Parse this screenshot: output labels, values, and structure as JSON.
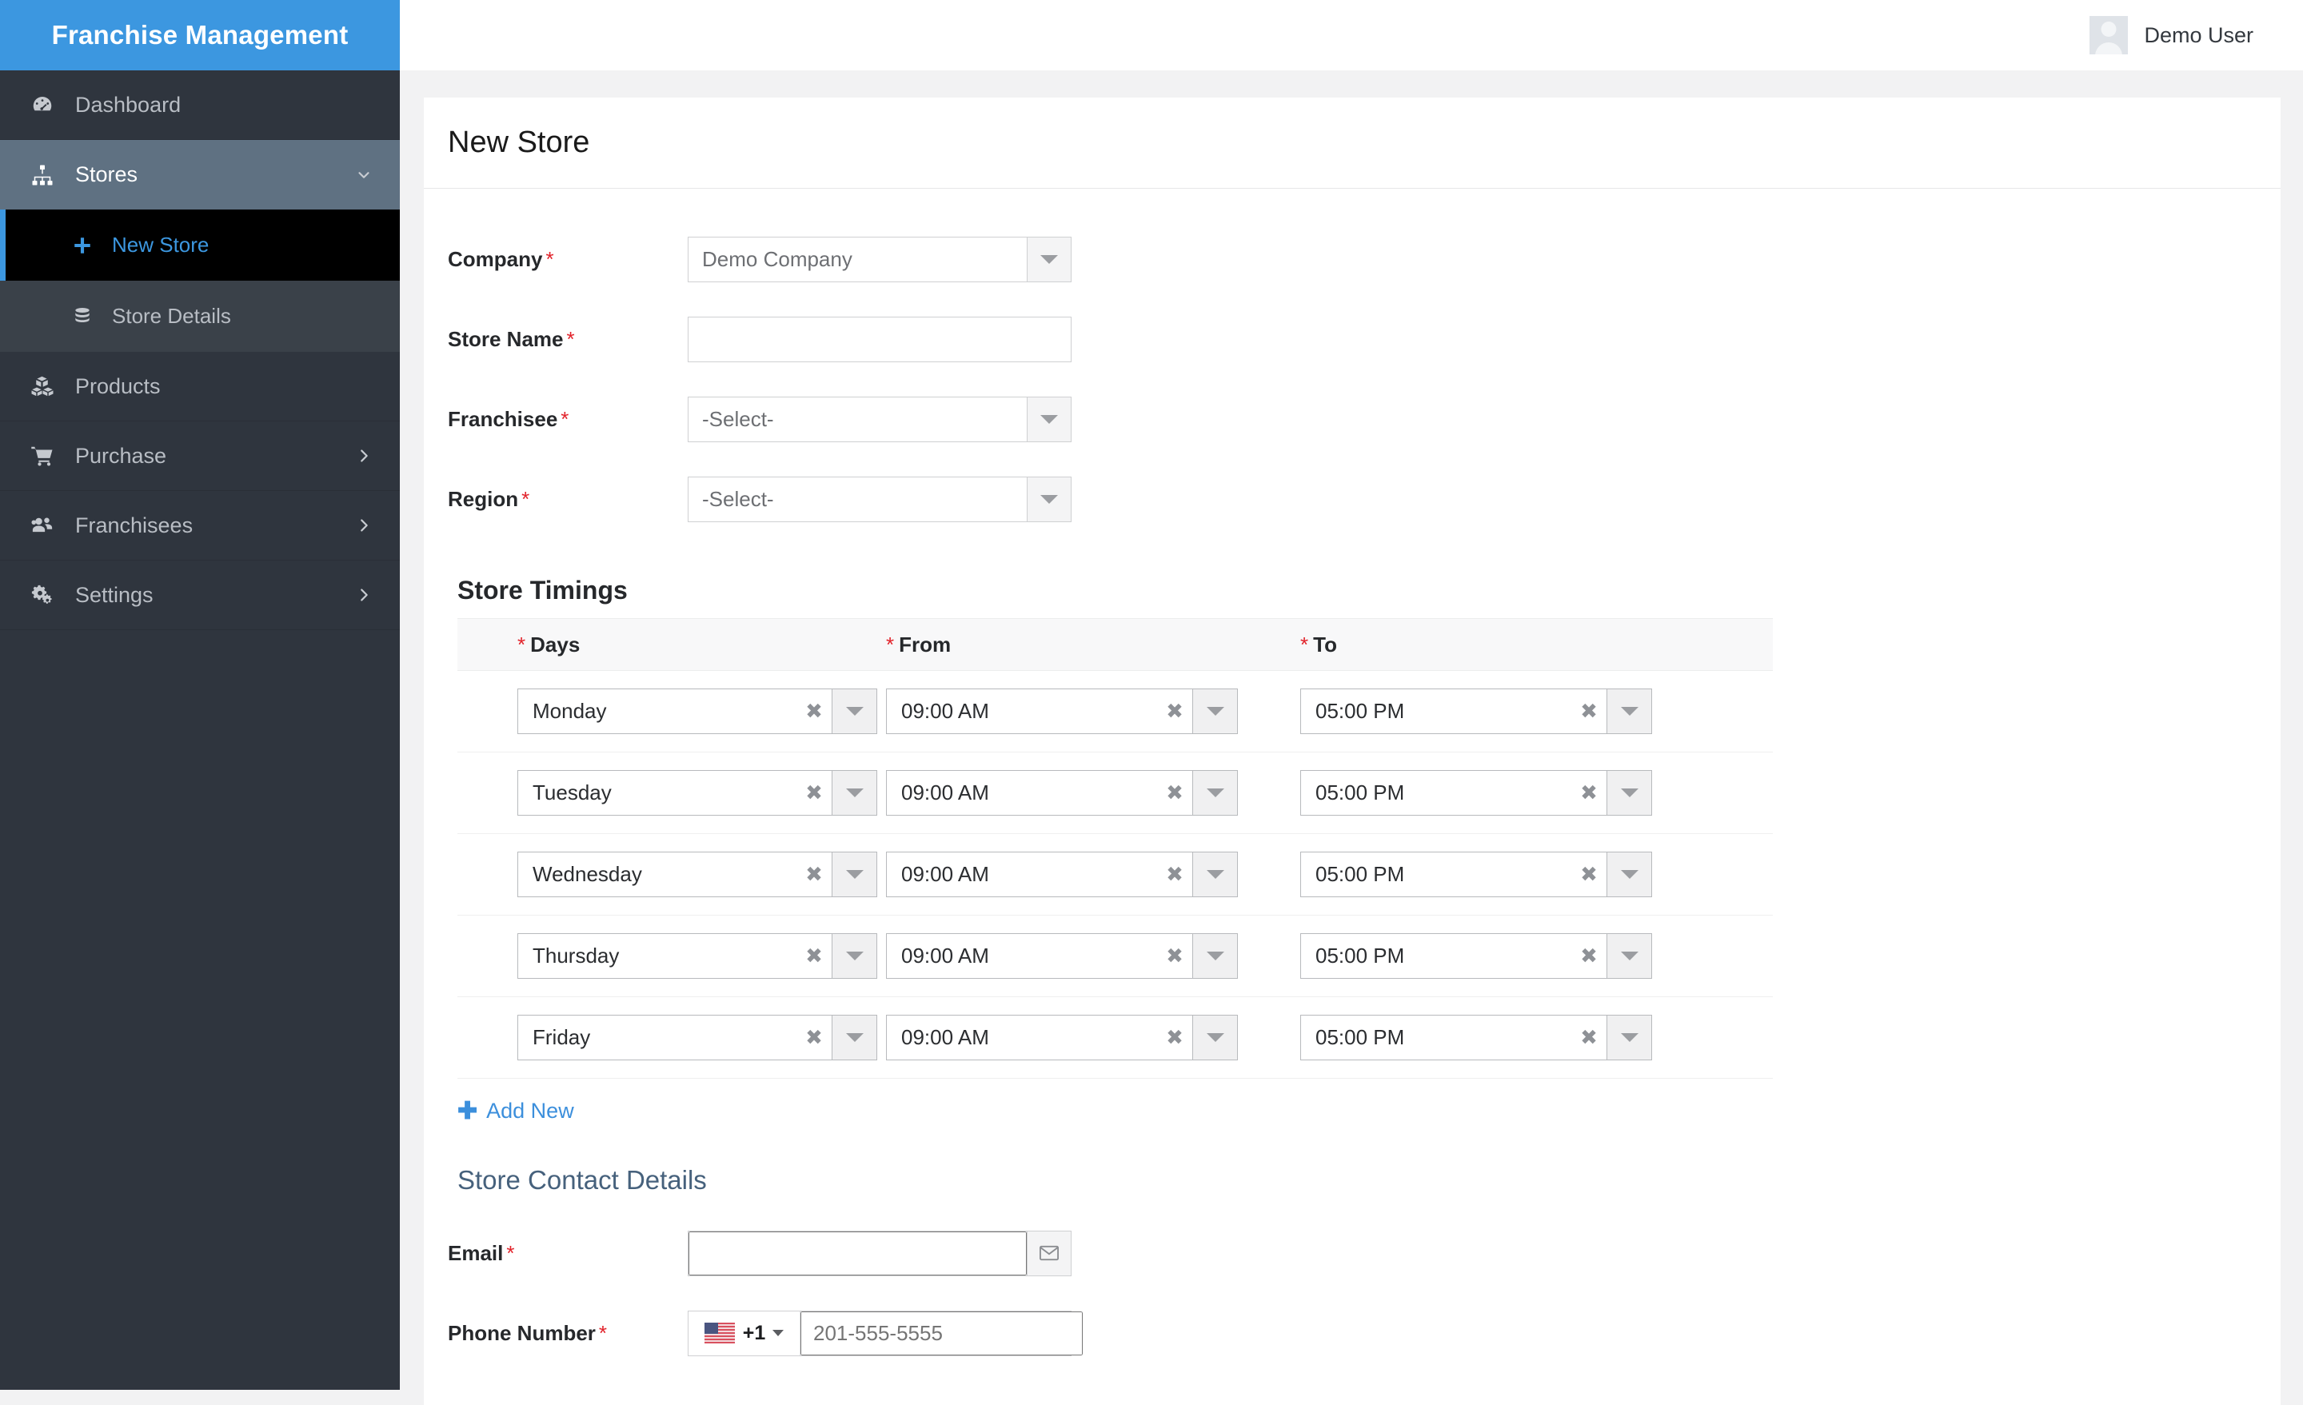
{
  "brand": {
    "title": "Franchise Management"
  },
  "topbar": {
    "user_name": "Demo User"
  },
  "sidebar": {
    "items": [
      {
        "label": "Dashboard",
        "icon": "dashboard-icon",
        "caret": ""
      },
      {
        "label": "Stores",
        "icon": "sitemap-icon",
        "caret": "chevron-down-icon"
      },
      {
        "label": "Products",
        "icon": "boxes-icon",
        "caret": ""
      },
      {
        "label": "Purchase",
        "icon": "shopping-cart-icon",
        "caret": "chevron-right-icon"
      },
      {
        "label": "Franchisees",
        "icon": "users-icon",
        "caret": "chevron-right-icon"
      },
      {
        "label": "Settings",
        "icon": "gears-icon",
        "caret": "chevron-right-icon"
      }
    ],
    "sub_items": [
      {
        "label": "New Store",
        "icon": "plus-icon"
      },
      {
        "label": "Store Details",
        "icon": "database-icon"
      }
    ]
  },
  "page": {
    "title": "New Store"
  },
  "form": {
    "company": {
      "label": "Company",
      "required": "*",
      "value": "Demo Company"
    },
    "store_name": {
      "label": "Store Name",
      "required": "*",
      "value": ""
    },
    "franchisee": {
      "label": "Franchisee",
      "required": "*",
      "value": "-Select-"
    },
    "region": {
      "label": "Region",
      "required": "*",
      "value": "-Select-"
    }
  },
  "timings": {
    "title": "Store Timings",
    "required_marker": "*",
    "columns": [
      "Days",
      "From",
      "To"
    ],
    "rows": [
      {
        "day": "Monday",
        "from": "09:00 AM",
        "to": "05:00 PM"
      },
      {
        "day": "Tuesday",
        "from": "09:00 AM",
        "to": "05:00 PM"
      },
      {
        "day": "Wednesday",
        "from": "09:00 AM",
        "to": "05:00 PM"
      },
      {
        "day": "Thursday",
        "from": "09:00 AM",
        "to": "05:00 PM"
      },
      {
        "day": "Friday",
        "from": "09:00 AM",
        "to": "05:00 PM"
      }
    ],
    "clear_glyph": "✖",
    "add_new_label": "Add New",
    "add_new_glyph": "✚"
  },
  "contact": {
    "title": "Store Contact Details",
    "email": {
      "label": "Email",
      "required": "*",
      "value": "",
      "icon": "envelope-icon"
    },
    "phone": {
      "label": "Phone Number",
      "required": "*",
      "country_code": "+1",
      "flag": "us-flag-icon",
      "placeholder": "201-555-5555",
      "value": ""
    }
  },
  "colors": {
    "brand_blue": "#3c97e0",
    "sidebar_bg": "#2f353e",
    "sidebar_active": "#5f7182",
    "current_item_bg": "#000000",
    "link_blue": "#3c8fdc",
    "required_red": "#e2232b",
    "section_heading": "#46617c"
  }
}
